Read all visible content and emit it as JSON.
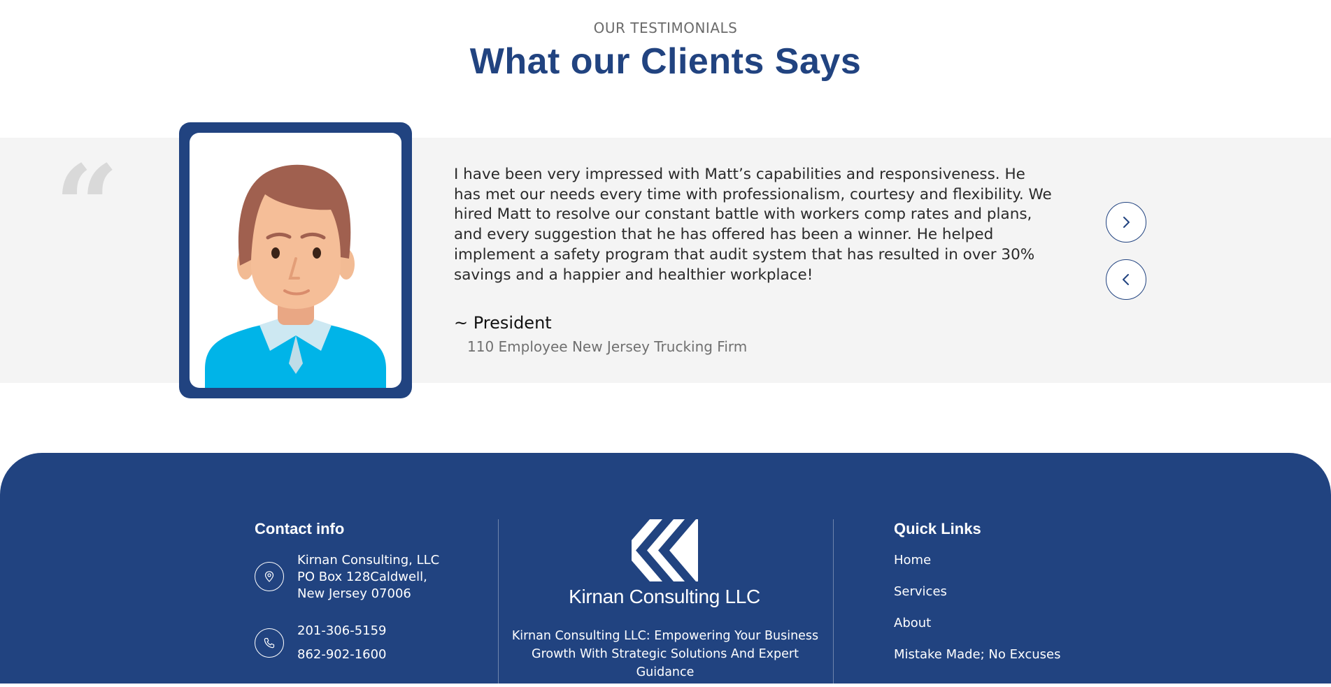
{
  "testimonials": {
    "eyebrow": "OUR TESTIMONIALS",
    "heading": "What our Clients Says",
    "quote": "I have been very impressed with Matt’s capabilities and responsiveness. He has met our needs every time with professionalism, courtesy and flexibility. We hired Matt to resolve our constant battle with workers comp rates and plans, and every suggestion that he has offered has been a winner. He helped implement a safety program that audit system that has resulted in over 30% savings and a happier and healthier workplace!",
    "author": "~ President",
    "company": "110 Employee New Jersey Trucking Firm",
    "quote_mark": "“",
    "next_icon": "chevron-right-icon",
    "prev_icon": "chevron-left-icon"
  },
  "footer": {
    "contact": {
      "title": "Contact info",
      "address_lines": [
        "Kirnan Consulting, LLC",
        "PO Box 128Caldwell,",
        "New Jersey 07006"
      ],
      "phones": [
        "201-306-5159",
        "862-902-1600"
      ],
      "location_icon": "map-pin-icon",
      "phone_icon": "phone-icon"
    },
    "brand": {
      "name": "Kirnan Consulting LLC",
      "tagline": "Kirnan Consulting LLC: Empowering Your Business Growth With Strategic Solutions And Expert Guidance"
    },
    "quick_links": {
      "title": "Quick Links",
      "items": [
        "Home",
        "Services",
        "About",
        "Mistake Made; No Excuses"
      ]
    }
  },
  "colors": {
    "brand_navy": "#214380",
    "band_gray": "#f4f4f4",
    "shirt_blue": "#00b4e8"
  }
}
